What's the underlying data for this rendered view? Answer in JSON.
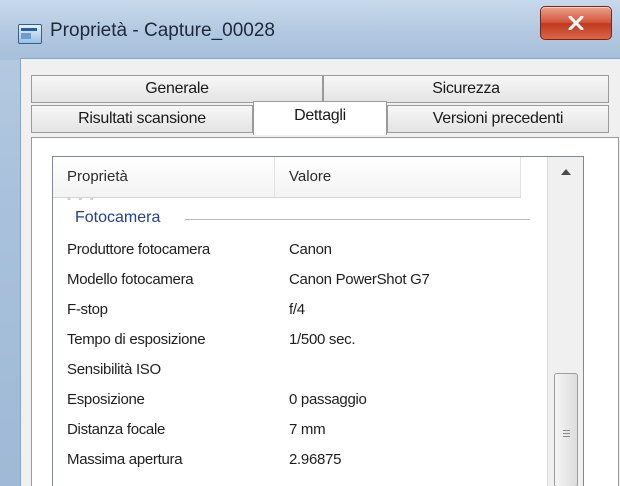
{
  "window": {
    "title": "Proprietà - Capture_00028",
    "close_glyph": "✕"
  },
  "tabs": {
    "back": [
      {
        "label": "Generale"
      },
      {
        "label": "Sicurezza"
      }
    ],
    "front": [
      {
        "label": "Risultati scansione"
      },
      {
        "label": "Dettagli",
        "active": true
      },
      {
        "label": "Versioni precedenti"
      }
    ]
  },
  "list": {
    "headers": {
      "property": "Proprietà",
      "value": "Valore"
    },
    "group": "Fotocamera",
    "rows": [
      {
        "property": "Produttore fotocamera",
        "value": "Canon"
      },
      {
        "property": "Modello fotocamera",
        "value": "Canon PowerShot G7"
      },
      {
        "property": "F-stop",
        "value": "f/4"
      },
      {
        "property": "Tempo di esposizione",
        "value": "1/500 sec."
      },
      {
        "property": "Sensibilità ISO",
        "value": ""
      },
      {
        "property": "Esposizione",
        "value": "0 passaggio"
      },
      {
        "property": "Distanza focale",
        "value": "7 mm"
      },
      {
        "property": "Massima apertura",
        "value": "2.96875"
      }
    ]
  },
  "colors": {
    "close_button": "#c9452a",
    "group_label": "#1f3f9a",
    "title_bar": "#b2c8e0"
  },
  "icons": {
    "app": "properties-window-icon",
    "close": "close-icon",
    "scroll_up": "chevron-up-icon",
    "grip": "scroll-grip-icon"
  }
}
